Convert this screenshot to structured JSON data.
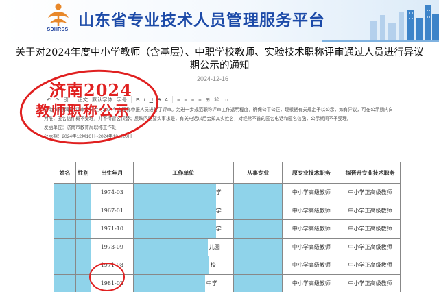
{
  "header": {
    "logo_text": "SDHRSS",
    "site_title": "山东省专业技术人员管理服务平台"
  },
  "notice": {
    "title_line1": "关于对2024年度中小学教师（含基层）、中职学校教师、实验技术职称评审通过人员进行异议",
    "title_line2": "期公示的通知",
    "date": "2024-12-16"
  },
  "editor": {
    "toolbar": [
      "↶",
      "↷",
      "引",
      "字段",
      "正文",
      "默认字体",
      "字号",
      "B",
      "I",
      "U",
      "S",
      "A",
      "≡",
      "≡",
      "≡",
      "≡",
      "⊞",
      "⌘",
      "⋯"
    ],
    "paragraph1": "济南市教师职务评审委员会对2024年度职称申报人员进行了评审。为进一步规范职称评审工作透明程度，确保公平公正，现根据有关规定予以公示，如有异议，可在公示期内向市教育局反映（信函以",
    "paragraph2": "为准，匿名信件概不受理，并不得冒名顶替；反映问题要实事求是，有关电话以后会知其实姓名，对经常不善的匿名电话和匿名信函，公示期间不予受理。",
    "sender": "发函单位：济南市教育局职称工作处",
    "period": "公示期：2024年12月16日~2024年12月20日"
  },
  "stamp": {
    "line1": "济南2024",
    "line2": "教师职称公示"
  },
  "table": {
    "headers": [
      "姓名",
      "性别",
      "出生年月",
      "工作单位",
      "从事专业",
      "原专业技术职务",
      "拟晋升专业技术职务"
    ],
    "rows": [
      {
        "birth": "1974-03",
        "unit": "学",
        "orig": "中小学高级教师",
        "new": "中小学正高级教师"
      },
      {
        "birth": "1967-01",
        "unit": "学",
        "orig": "中小学高级教师",
        "new": "中小学正高级教师"
      },
      {
        "birth": "1971-10",
        "unit": "学",
        "orig": "中小学高级教师",
        "new": "中小学正高级教师"
      },
      {
        "birth": "1973-09",
        "unit": "儿园",
        "orig": "中小学高级教师",
        "new": "中小学正高级教师"
      },
      {
        "birth": "1971-08",
        "unit": "校",
        "orig": "中小学高级教师",
        "new": "中小学正高级教师"
      },
      {
        "birth": "1981-02",
        "unit": "中学",
        "orig": "中小学高级教师",
        "new": "中小学正高级教师"
      }
    ]
  },
  "colors": {
    "title_blue": "#1c4aa8",
    "stamp_red": "#e02020",
    "redaction": "#8fd3ea"
  }
}
